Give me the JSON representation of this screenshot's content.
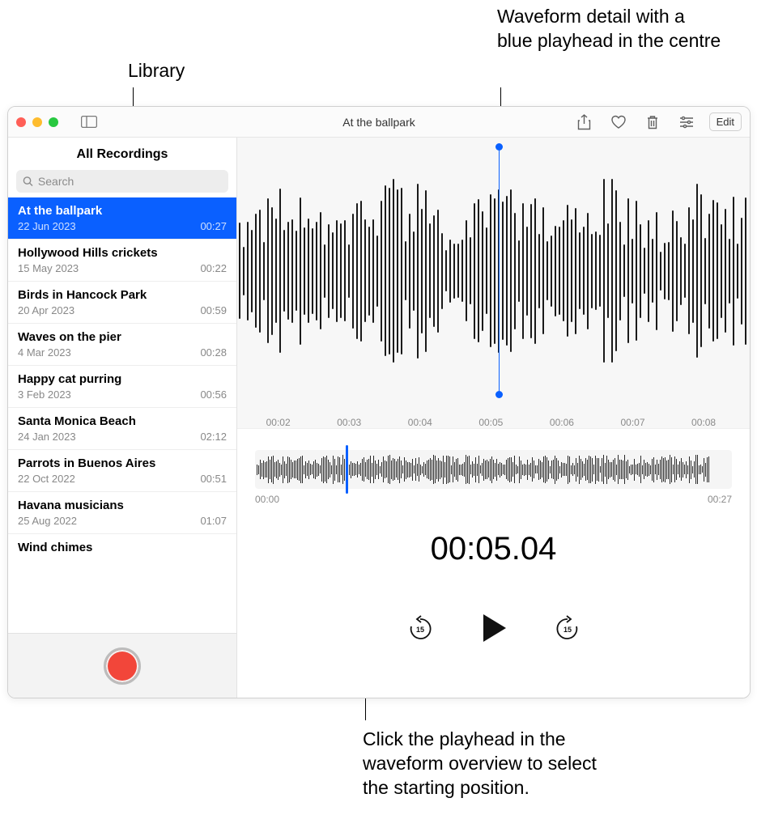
{
  "callouts": {
    "library": "Library",
    "waveform_detail": "Waveform detail with a blue playhead in the centre",
    "overview_hint": "Click the playhead in the waveform overview to select the starting position."
  },
  "window_title": "At the ballpark",
  "toolbar": {
    "edit_label": "Edit"
  },
  "sidebar": {
    "header": "All Recordings",
    "search_placeholder": "Search",
    "items": [
      {
        "title": "At the ballpark",
        "date": "22 Jun 2023",
        "duration": "00:27",
        "selected": true
      },
      {
        "title": "Hollywood Hills crickets",
        "date": "15 May 2023",
        "duration": "00:22"
      },
      {
        "title": "Birds in Hancock Park",
        "date": "20 Apr 2023",
        "duration": "00:59"
      },
      {
        "title": "Waves on the pier",
        "date": "4 Mar 2023",
        "duration": "00:28"
      },
      {
        "title": "Happy cat purring",
        "date": "3 Feb 2023",
        "duration": "00:56"
      },
      {
        "title": "Santa Monica Beach",
        "date": "24 Jan 2023",
        "duration": "02:12"
      },
      {
        "title": "Parrots in Buenos Aires",
        "date": "22 Oct 2022",
        "duration": "00:51"
      },
      {
        "title": "Havana musicians",
        "date": "25 Aug 2022",
        "duration": "01:07"
      },
      {
        "title": "Wind chimes",
        "date": "",
        "duration": ""
      }
    ]
  },
  "detail": {
    "ticks": [
      "00:02",
      "00:03",
      "00:04",
      "00:05",
      "00:06",
      "00:07",
      "00:08"
    ],
    "playhead_percent": 51
  },
  "overview": {
    "start": "00:00",
    "end": "00:27",
    "playhead_percent": 19
  },
  "time_display": "00:05.04"
}
